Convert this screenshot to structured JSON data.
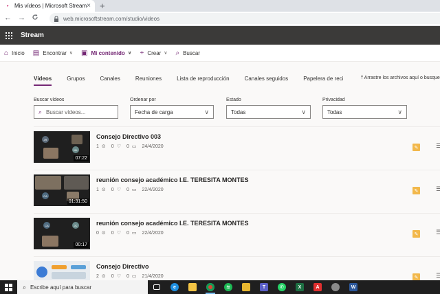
{
  "browser": {
    "tab_title": "Mis vídeos | Microsoft Stream",
    "tab_close": "×",
    "new_tab": "+",
    "back": "←",
    "forward": "→",
    "reload": "C",
    "url": "web.microsoftstream.com/studio/videos"
  },
  "app": {
    "name": "Stream"
  },
  "commandbar": {
    "items": [
      {
        "label": "Inicio",
        "icon": "home-icon"
      },
      {
        "label": "Encontrar",
        "icon": "find-icon",
        "chevron": true
      },
      {
        "label": "Mi contenido",
        "icon": "my-content-icon",
        "chevron": true,
        "active": true
      },
      {
        "label": "Crear",
        "icon": "plus-icon",
        "chevron": true
      },
      {
        "label": "Buscar",
        "icon": "search-icon"
      }
    ]
  },
  "pivots": {
    "items": [
      "Vídeos",
      "Grupos",
      "Canales",
      "Reuniones",
      "Lista de reproducción",
      "Canales seguidos",
      "Papelera de reci"
    ],
    "active_index": 0,
    "drop_hint": "Arrastre los archivos aquí o busque"
  },
  "filters": {
    "search": {
      "label": "Buscar vídeos",
      "placeholder": "Buscar vídeos..."
    },
    "order": {
      "label": "Ordenar por",
      "value": "Fecha de carga"
    },
    "state": {
      "label": "Estado",
      "value": "Todas"
    },
    "privacy": {
      "label": "Privacidad",
      "value": "Todas"
    }
  },
  "videos": [
    {
      "title": "Consejo Directivo 003",
      "views": "1",
      "likes": "0",
      "comments": "0",
      "date": "24/4/2020",
      "duration": "07:22"
    },
    {
      "title": "reunión consejo académico I.E. TERESITA MONTES",
      "views": "1",
      "likes": "0",
      "comments": "0",
      "date": "22/4/2020",
      "duration": "01:31:50"
    },
    {
      "title": "reunión consejo académico I.E. TERESITA MONTES",
      "views": "0",
      "likes": "0",
      "comments": "0",
      "date": "22/4/2020",
      "duration": "00:17"
    },
    {
      "title": "Consejo Directivo",
      "views": "2",
      "likes": "0",
      "comments": "0",
      "date": "21/4/2020",
      "duration": ""
    }
  ],
  "taskbar": {
    "search_placeholder": "Escribe aquí para buscar",
    "apps": [
      "task-view-icon",
      "edge-icon",
      "file-explorer-icon",
      "chrome-icon",
      "spotify-icon",
      "photos-icon",
      "teams-icon",
      "whatsapp-icon",
      "excel-icon",
      "acrobat-icon",
      "network-icon",
      "word-icon"
    ]
  },
  "colors": {
    "accent": "#742774",
    "header": "#3b3a39",
    "badge": "#f2b84b"
  }
}
